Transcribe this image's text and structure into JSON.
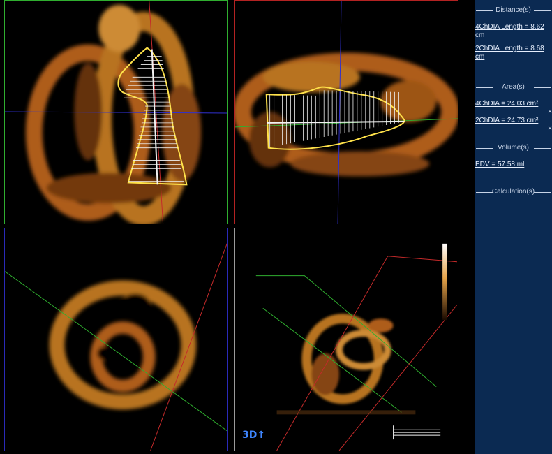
{
  "panels": {
    "distance": {
      "header": "Distance(s)",
      "items": [
        {
          "label": "4ChDIA Length = 8.62 cm"
        },
        {
          "label": "2ChDIA Length = 8.68 cm"
        }
      ]
    },
    "area": {
      "header": "Area(s)",
      "items": [
        {
          "label": "4ChDIA = 24.03 cm²",
          "close": "×"
        },
        {
          "label": "2ChDIA = 24.73 cm²",
          "close": "×"
        }
      ]
    },
    "volume": {
      "header": "Volume(s)",
      "items": [
        {
          "label": "EDV = 57.58 ml"
        }
      ]
    },
    "calculation": {
      "header": "Calculation(s)"
    }
  },
  "viewports": {
    "render_badge": "3D↑"
  },
  "colors": {
    "panel_bg": "#0b2a52",
    "contour": "#ffe24a",
    "tissue": "#c27a22",
    "axis_green": "#2fae2f",
    "axis_red": "#c42a2a",
    "axis_blue": "#3030d0"
  }
}
